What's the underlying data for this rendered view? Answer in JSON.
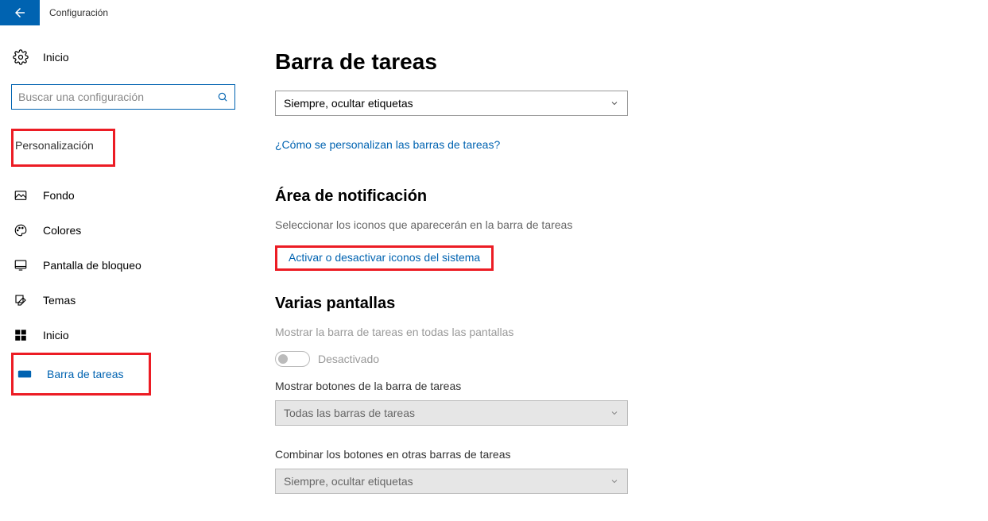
{
  "topbar": {
    "title": "Configuración"
  },
  "sidebar": {
    "home": "Inicio",
    "search_placeholder": "Buscar una configuración",
    "section": "Personalización",
    "items": [
      {
        "label": "Fondo"
      },
      {
        "label": "Colores"
      },
      {
        "label": "Pantalla de bloqueo"
      },
      {
        "label": "Temas"
      },
      {
        "label": "Inicio"
      },
      {
        "label": "Barra de tareas"
      }
    ]
  },
  "main": {
    "title": "Barra de tareas",
    "select_combine": "Siempre, ocultar etiquetas",
    "link_customize": "¿Cómo se personalizan las barras de tareas?",
    "notif_head": "Área de notificación",
    "notif_desc": "Seleccionar los iconos que aparecerán en la barra de tareas",
    "link_system_icons": "Activar o desactivar iconos del sistema",
    "multi_head": "Varias pantallas",
    "multi_desc": "Mostrar la barra de tareas en todas las pantallas",
    "toggle_state": "Desactivado",
    "buttons_label": "Mostrar botones de la barra de tareas",
    "buttons_value": "Todas las barras de tareas",
    "combine_label": "Combinar los botones en otras barras de tareas",
    "combine_value": "Siempre, ocultar etiquetas"
  }
}
